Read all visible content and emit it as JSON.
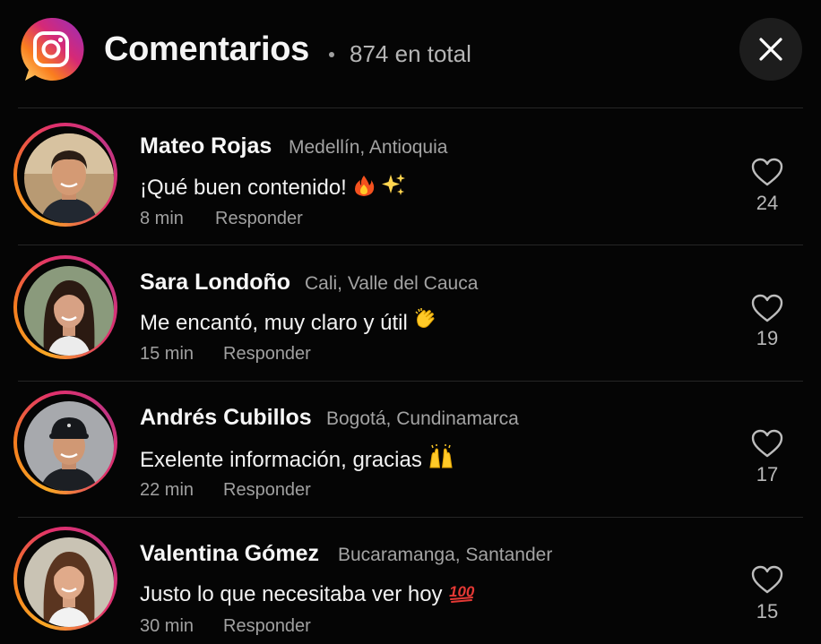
{
  "header": {
    "title": "Comentarios",
    "total": "874 en total",
    "close_icon": "close-icon",
    "logo_icon": "instagram-logo-icon"
  },
  "comments": [
    {
      "name": "Mateo Rojas",
      "location": "Medellín, Antioquia",
      "text": "¡Qué buen contenido!",
      "emoji": [
        "fire-emoji",
        "sparkles-emoji"
      ],
      "time": "8 min",
      "reply": "Responder",
      "likes": "24"
    },
    {
      "name": "Sara Londoño",
      "location": "Cali, Valle del Cauca",
      "text": "Me encantó, muy claro y útil",
      "emoji": [
        "clapping-hands-emoji"
      ],
      "time": "15 min",
      "reply": "Responder",
      "likes": "19"
    },
    {
      "name": "Andrés Cubillos",
      "location": "Bogotá, Cundinamarca",
      "text": "Exelente información, gracias",
      "emoji": [
        "raising-hands-emoji"
      ],
      "time": "22 min",
      "reply": "Responder",
      "likes": "17"
    },
    {
      "name": "Valentina Gómez",
      "location": "Bucaramanga, Santander",
      "text": "Justo lo que necesitaba ver hoy",
      "emoji": [
        "hundred-points-emoji"
      ],
      "time": "30 min",
      "reply": "Responder",
      "likes": "15"
    }
  ],
  "colors": {
    "background": "#050505",
    "text_primary": "#f5f5f5",
    "text_secondary": "#a3a3a3",
    "divider": "#262626",
    "ring_gradient": [
      "#f9a825",
      "#e1306c",
      "#c13584"
    ]
  }
}
